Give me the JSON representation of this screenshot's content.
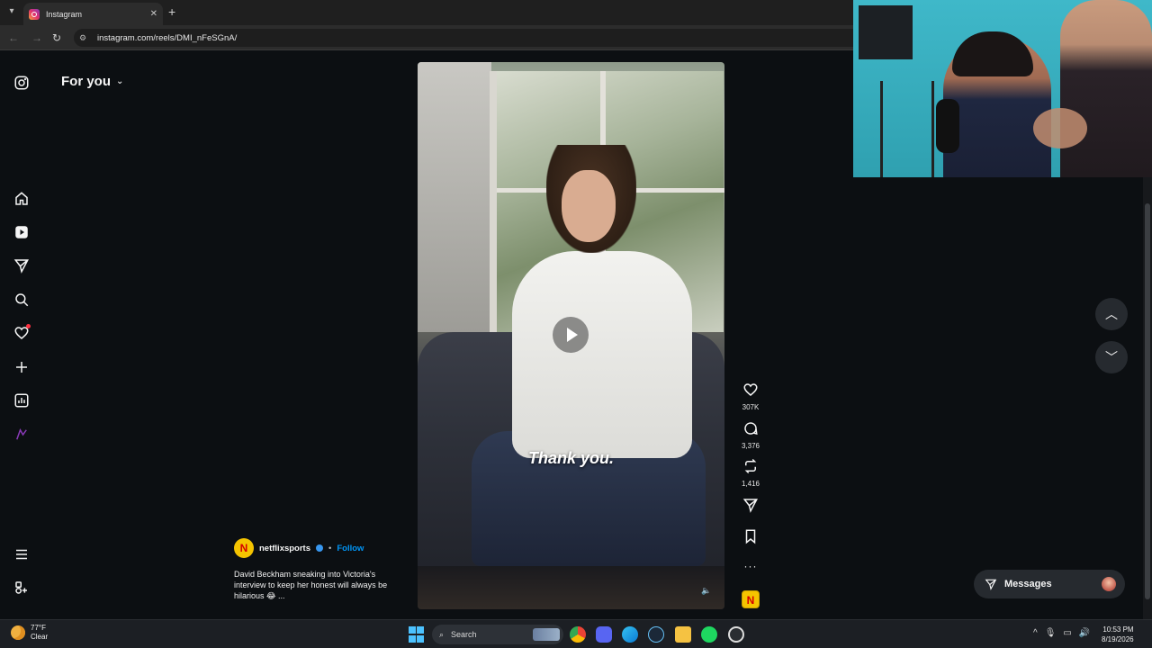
{
  "browser": {
    "tab_title": "Instagram",
    "url": "instagram.com/reels/DMI_nFeSGnA/"
  },
  "feed": {
    "heading": "For you"
  },
  "video": {
    "subtitle": "Thank you."
  },
  "actions": {
    "likes": "307K",
    "comments": "3,376",
    "reposts": "1,416"
  },
  "post": {
    "author": "netflixsports",
    "separator": "•",
    "follow_label": "Follow",
    "caption": "David Beckham sneaking into Victoria's interview to keep her honest will always be hilarious 😂 ...",
    "avatar_letter": "N"
  },
  "messages": {
    "label": "Messages"
  },
  "taskbar": {
    "temperature": "77°F",
    "condition": "Clear",
    "search_label": "Search",
    "time": "10:53 PM",
    "date": "8/19/2026"
  },
  "colors": {
    "accent_blue": "#0095f6",
    "notification_red": "#ff3040",
    "background": "#0c0f12"
  }
}
